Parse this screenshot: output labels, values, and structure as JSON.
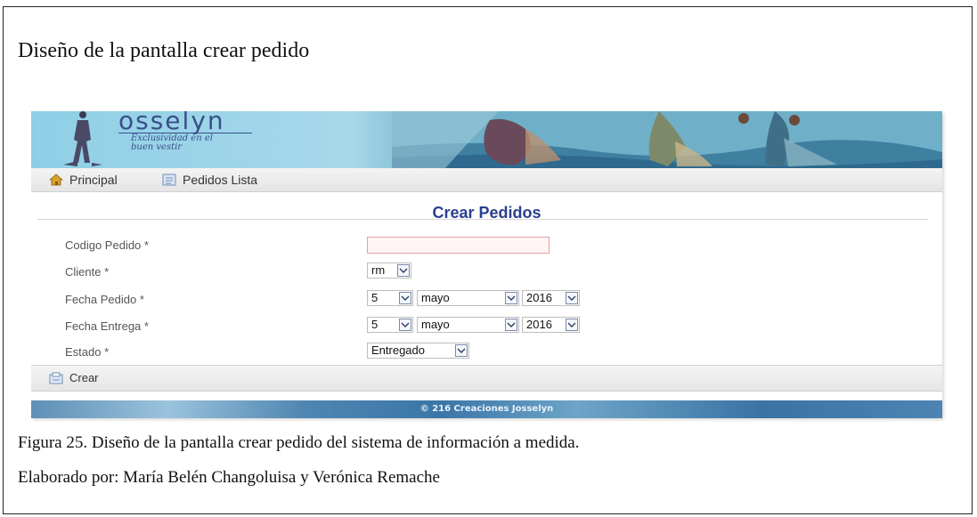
{
  "document": {
    "title": "Diseño de la pantalla crear pedido",
    "caption": "Figura 25. Diseño de la pantalla crear pedido del sistema de información a medida.",
    "credit": "Elaborado por: María Belén Changoluisa y Verónica Remache"
  },
  "app": {
    "logo_text": "osselyn",
    "tagline_line1": "Exclusividad en el",
    "tagline_line2": "buen vestir",
    "nav": {
      "principal": "Principal",
      "pedidos_lista": "Pedidos Lista"
    },
    "form": {
      "title": "Crear Pedidos",
      "fields": {
        "codigo": {
          "label": "Codigo Pedido *",
          "value": ""
        },
        "cliente": {
          "label": "Cliente *",
          "value": "rm"
        },
        "fecha_pedido": {
          "label": "Fecha Pedido *",
          "day": "5",
          "month": "mayo",
          "year": "2016"
        },
        "fecha_entrega": {
          "label": "Fecha Entrega *",
          "day": "5",
          "month": "mayo",
          "year": "2016"
        },
        "estado": {
          "label": "Estado *",
          "value": "Entregado"
        }
      }
    },
    "actions": {
      "crear": "Crear"
    },
    "footer": "© 216 Creaciones Josselyn"
  },
  "colors": {
    "title_blue": "#2a3f8f",
    "invalid_border": "#e6a0a0",
    "banner": "#8fcfe6"
  },
  "icons": [
    "home-icon",
    "list-icon",
    "dropdown-arrow-icon",
    "create-icon"
  ]
}
